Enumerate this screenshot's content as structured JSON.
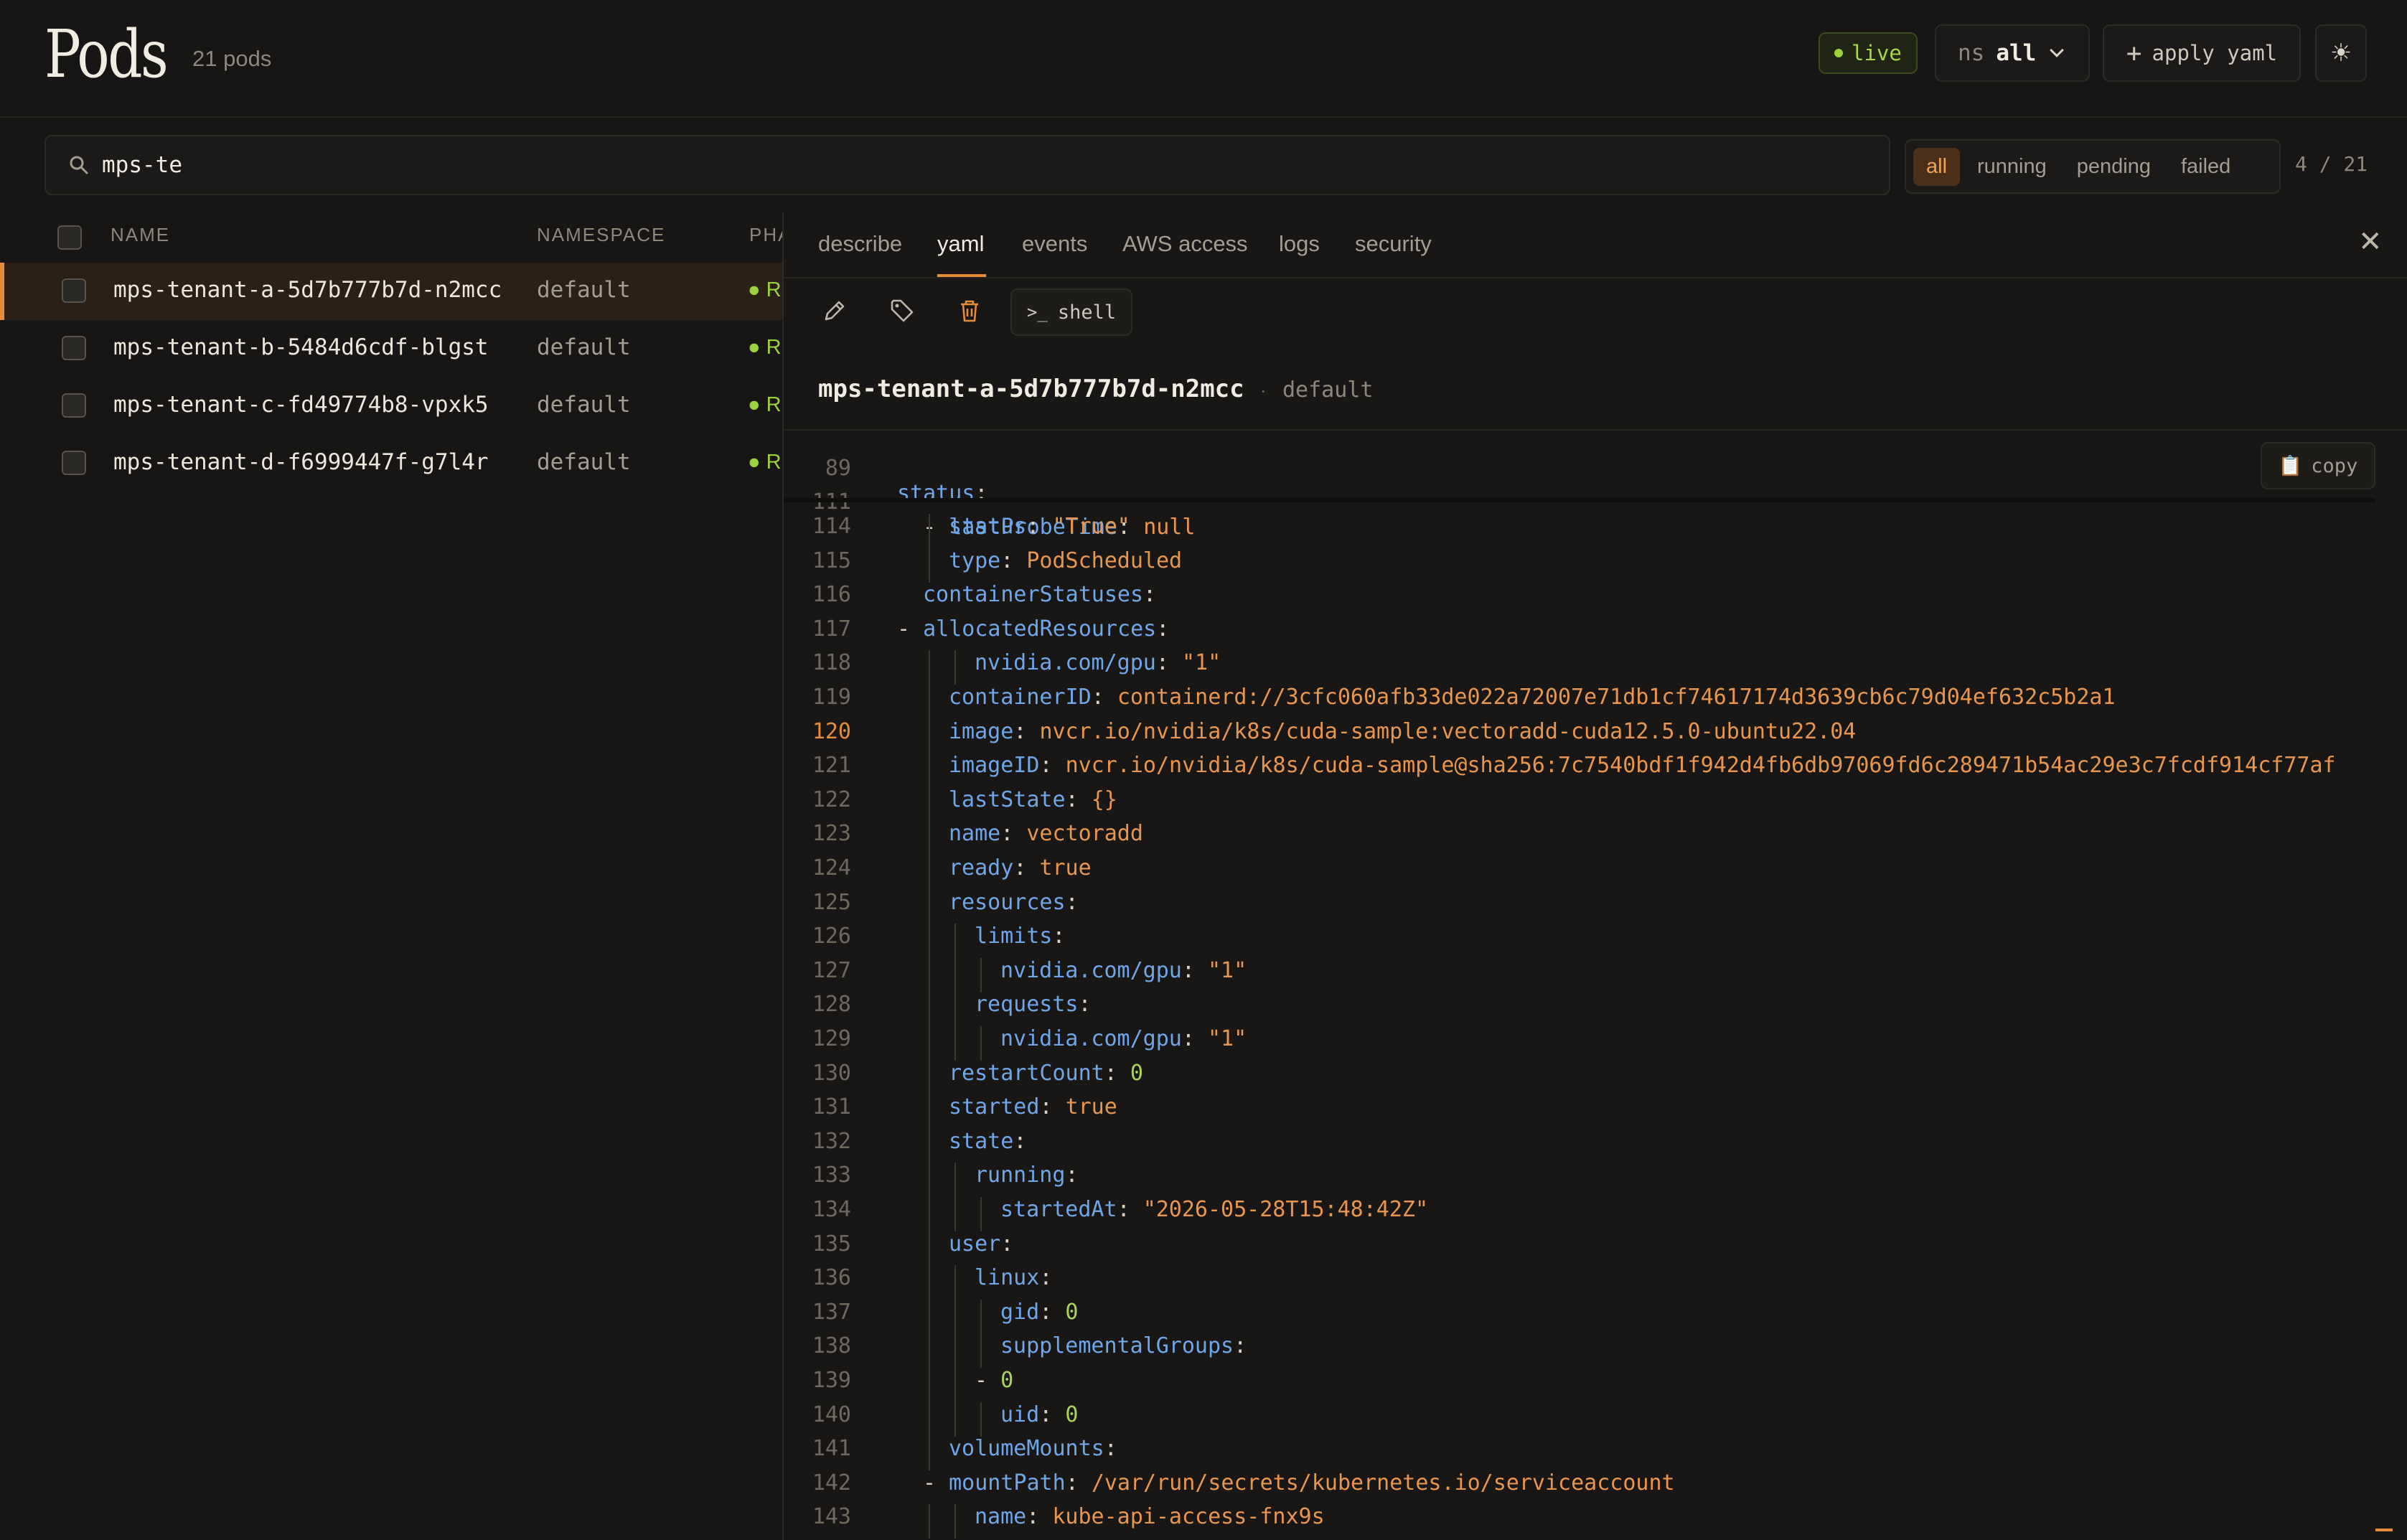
{
  "header": {
    "title": "Pods",
    "pod_count": "21 pods",
    "live_label": "live",
    "ns_label": "ns",
    "ns_value": "all",
    "apply_label": "apply yaml"
  },
  "search": {
    "value": "mps-te"
  },
  "filters": {
    "items": [
      "all",
      "running",
      "pending",
      "failed"
    ],
    "active": "all",
    "count": "4 / 21"
  },
  "table": {
    "columns": [
      "NAME",
      "NAMESPACE",
      "PHA"
    ],
    "rows": [
      {
        "name": "mps-tenant-a-5d7b777b7d-n2mcc",
        "namespace": "default",
        "phase": "R"
      },
      {
        "name": "mps-tenant-b-5484d6cdf-blgst",
        "namespace": "default",
        "phase": "R"
      },
      {
        "name": "mps-tenant-c-fd49774b8-vpxk5",
        "namespace": "default",
        "phase": "R"
      },
      {
        "name": "mps-tenant-d-f6999447f-g7l4r",
        "namespace": "default",
        "phase": "R"
      }
    ]
  },
  "detail": {
    "tabs": [
      "describe",
      "yaml",
      "events",
      "AWS access",
      "logs",
      "security"
    ],
    "active_tab": "yaml",
    "shell_label": "shell",
    "resource_name": "mps-tenant-a-5d7b777b7d-n2mcc",
    "resource_sep": "·",
    "resource_namespace": "default",
    "copy_label": "copy",
    "sticky_lines": [
      {
        "n": "89",
        "text": "status:"
      },
      {
        "n": "111",
        "text": "  - lastProbeTime: null"
      }
    ],
    "yaml_lines": [
      {
        "n": "114",
        "key": "status",
        "val": "\"True\"",
        "kind": "s",
        "indent": 2
      },
      {
        "n": "115",
        "key": "type",
        "val": "PodScheduled",
        "kind": "s",
        "indent": 2
      },
      {
        "n": "116",
        "key": "containerStatuses",
        "val": "",
        "kind": "",
        "indent": 1
      },
      {
        "n": "117",
        "key": "allocatedResources",
        "val": "",
        "kind": "",
        "indent": 1,
        "dash": true
      },
      {
        "n": "118",
        "key": "nvidia.com/gpu",
        "val": "\"1\"",
        "kind": "s",
        "indent": 3
      },
      {
        "n": "119",
        "key": "containerID",
        "val": "containerd://3cfc060afb33de022a72007e71db1cf74617174d3639cb6c79d04ef632c5b2a1",
        "kind": "s",
        "indent": 2
      },
      {
        "n": "120",
        "key": "image",
        "val": "nvcr.io/nvidia/k8s/cuda-sample:vectoradd-cuda12.5.0-ubuntu22.04",
        "kind": "s",
        "indent": 2,
        "hl": true
      },
      {
        "n": "121",
        "key": "imageID",
        "val": "nvcr.io/nvidia/k8s/cuda-sample@sha256:7c7540bdf1f942d4fb6db97069fd6c289471b54ac29e3c7fcdf914cf77af",
        "kind": "s",
        "indent": 2
      },
      {
        "n": "122",
        "key": "lastState",
        "val": "{}",
        "kind": "s",
        "indent": 2
      },
      {
        "n": "123",
        "key": "name",
        "val": "vectoradd",
        "kind": "s",
        "indent": 2
      },
      {
        "n": "124",
        "key": "ready",
        "val": "true",
        "kind": "s",
        "indent": 2
      },
      {
        "n": "125",
        "key": "resources",
        "val": "",
        "kind": "",
        "indent": 2
      },
      {
        "n": "126",
        "key": "limits",
        "val": "",
        "kind": "",
        "indent": 3
      },
      {
        "n": "127",
        "key": "nvidia.com/gpu",
        "val": "\"1\"",
        "kind": "s",
        "indent": 4
      },
      {
        "n": "128",
        "key": "requests",
        "val": "",
        "kind": "",
        "indent": 3
      },
      {
        "n": "129",
        "key": "nvidia.com/gpu",
        "val": "\"1\"",
        "kind": "s",
        "indent": 4
      },
      {
        "n": "130",
        "key": "restartCount",
        "val": "0",
        "kind": "n",
        "indent": 2
      },
      {
        "n": "131",
        "key": "started",
        "val": "true",
        "kind": "s",
        "indent": 2
      },
      {
        "n": "132",
        "key": "state",
        "val": "",
        "kind": "",
        "indent": 2
      },
      {
        "n": "133",
        "key": "running",
        "val": "",
        "kind": "",
        "indent": 3
      },
      {
        "n": "134",
        "key": "startedAt",
        "val": "\"2026-05-28T15:48:42Z\"",
        "kind": "s",
        "indent": 4
      },
      {
        "n": "135",
        "key": "user",
        "val": "",
        "kind": "",
        "indent": 2
      },
      {
        "n": "136",
        "key": "linux",
        "val": "",
        "kind": "",
        "indent": 3
      },
      {
        "n": "137",
        "key": "gid",
        "val": "0",
        "kind": "n",
        "indent": 4
      },
      {
        "n": "138",
        "key": "supplementalGroups",
        "val": "",
        "kind": "",
        "indent": 4
      },
      {
        "n": "139",
        "key": "",
        "val": "0",
        "kind": "n",
        "indent": 4,
        "dash": true
      },
      {
        "n": "140",
        "key": "uid",
        "val": "0",
        "kind": "n",
        "indent": 4
      },
      {
        "n": "141",
        "key": "volumeMounts",
        "val": "",
        "kind": "",
        "indent": 2
      },
      {
        "n": "142",
        "key": "mountPath",
        "val": "/var/run/secrets/kubernetes.io/serviceaccount",
        "kind": "s",
        "indent": 2,
        "dash": true
      },
      {
        "n": "143",
        "key": "name",
        "val": "kube-api-access-fnx9s",
        "kind": "s",
        "indent": 3
      }
    ]
  }
}
